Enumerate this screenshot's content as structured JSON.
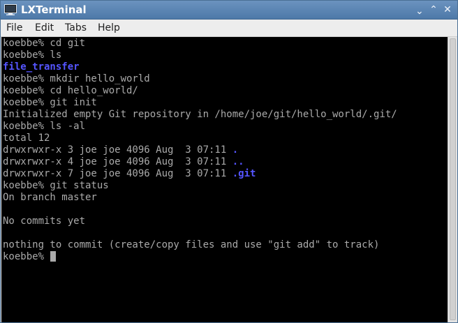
{
  "window": {
    "title": "LXTerminal",
    "minimize_glyph": "⌃",
    "maximize_glyph": "⌃",
    "close_glyph": "✕"
  },
  "menu": {
    "items": [
      "File",
      "Edit",
      "Tabs",
      "Help"
    ]
  },
  "terminal": {
    "colors": {
      "background": "#000000",
      "text": "#aaaaaa",
      "directory": "#5555ff"
    },
    "lines": [
      {
        "segments": [
          {
            "text": "koebbe% cd git"
          }
        ]
      },
      {
        "segments": [
          {
            "text": "koebbe% ls"
          }
        ]
      },
      {
        "segments": [
          {
            "text": "file_transfer",
            "style": "dir"
          }
        ]
      },
      {
        "segments": [
          {
            "text": "koebbe% mkdir hello_world"
          }
        ]
      },
      {
        "segments": [
          {
            "text": "koebbe% cd hello_world/"
          }
        ]
      },
      {
        "segments": [
          {
            "text": "koebbe% git init"
          }
        ]
      },
      {
        "segments": [
          {
            "text": "Initialized empty Git repository in /home/joe/git/hello_world/.git/"
          }
        ]
      },
      {
        "segments": [
          {
            "text": "koebbe% ls -al"
          }
        ]
      },
      {
        "segments": [
          {
            "text": "total 12"
          }
        ]
      },
      {
        "segments": [
          {
            "text": "drwxrwxr-x 3 joe joe 4096 Aug  3 07:11 "
          },
          {
            "text": ".",
            "style": "dir"
          }
        ]
      },
      {
        "segments": [
          {
            "text": "drwxrwxr-x 4 joe joe 4096 Aug  3 07:11 "
          },
          {
            "text": "..",
            "style": "dir"
          }
        ]
      },
      {
        "segments": [
          {
            "text": "drwxrwxr-x 7 joe joe 4096 Aug  3 07:11 "
          },
          {
            "text": ".git",
            "style": "dir"
          }
        ]
      },
      {
        "segments": [
          {
            "text": "koebbe% git status"
          }
        ]
      },
      {
        "segments": [
          {
            "text": "On branch master"
          }
        ]
      },
      {
        "segments": [
          {
            "text": ""
          }
        ]
      },
      {
        "segments": [
          {
            "text": "No commits yet"
          }
        ]
      },
      {
        "segments": [
          {
            "text": ""
          }
        ]
      },
      {
        "segments": [
          {
            "text": "nothing to commit (create/copy files and use \"git add\" to track)"
          }
        ]
      },
      {
        "segments": [
          {
            "text": "koebbe% "
          }
        ],
        "cursor": true
      }
    ]
  }
}
